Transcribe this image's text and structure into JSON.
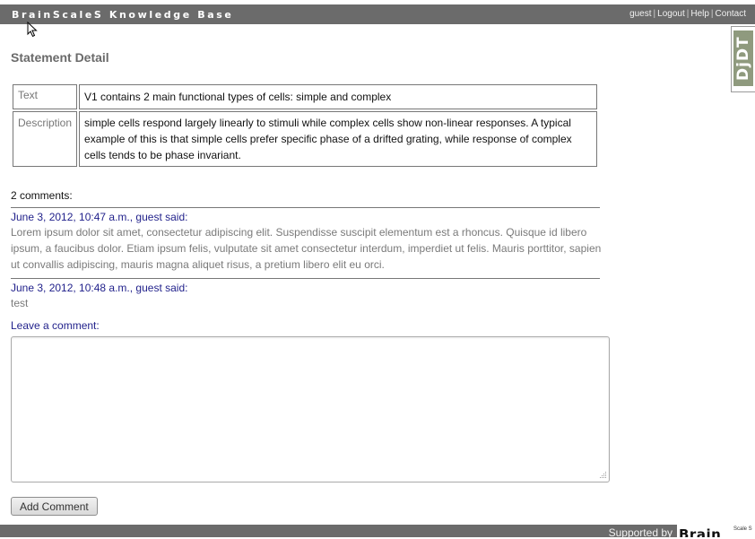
{
  "header": {
    "brand": "BrainScaleS Knowledge Base",
    "links": [
      "guest",
      "Logout",
      "Help",
      "Contact"
    ],
    "separator": "|"
  },
  "debug_toolbar": {
    "label": "DjDT"
  },
  "page": {
    "title": "Statement Detail"
  },
  "statement": {
    "rows": [
      {
        "key": "Text",
        "value": "V1 contains 2 main functional types of cells: simple and complex"
      },
      {
        "key": "Description",
        "value": "simple cells respond largely linearly to stimuli while complex cells show non-linear responses. A typical example of this is that simple cells prefer specific phase of a drifted grating, while response of complex cells tends to be phase invariant."
      }
    ]
  },
  "comments": {
    "count_label": "2 comments:",
    "items": [
      {
        "meta": "June 3, 2012, 10:47 a.m., guest said:",
        "body": "Lorem ipsum dolor sit amet, consectetur adipiscing elit. Suspendisse suscipit elementum est a rhoncus. Quisque id libero ipsum, a faucibus dolor. Etiam ipsum felis, vulputate sit amet consectetur interdum, imperdiet ut felis. Mauris porttitor, sapien ut convallis adipiscing, mauris magna aliquet risus, a pretium libero elit eu orci."
      },
      {
        "meta": "June 3, 2012, 10:48 a.m., guest said:",
        "body": "test"
      }
    ],
    "leave_label": "Leave a comment:",
    "textarea_value": "",
    "submit_label": "Add Comment"
  },
  "footer": {
    "supported_by": "Supported by",
    "logo_text": "Brain",
    "logo_small": "Scale S"
  },
  "colors": {
    "bar": "#6b6b6b",
    "link_blue": "#1f1f8a",
    "muted": "#7a7a7a"
  }
}
